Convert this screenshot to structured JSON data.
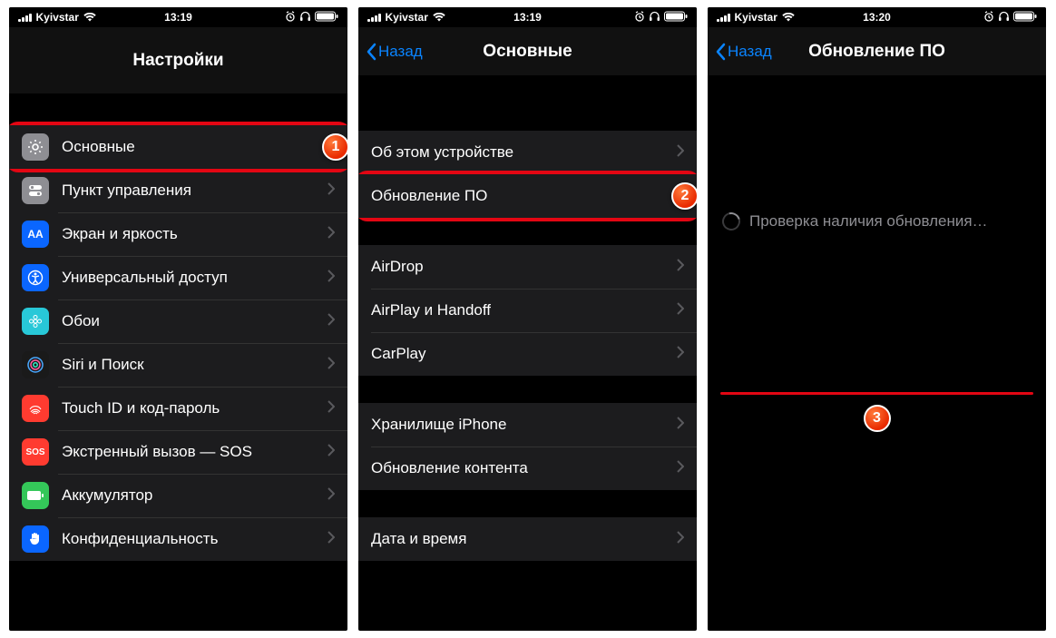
{
  "status": {
    "carrier": "Kyivstar",
    "time": "13:19",
    "time3": "13:20"
  },
  "screen1": {
    "title": "Настройки",
    "rows": {
      "general": "Основные",
      "control": "Пункт управления",
      "display": "Экран и яркость",
      "access": "Универсальный доступ",
      "wallpaper": "Обои",
      "siri": "Siri и Поиск",
      "touchid": "Touch ID и код-пароль",
      "sos": "Экстренный вызов — SOS",
      "battery": "Аккумулятор",
      "privacy": "Конфиденциальность"
    }
  },
  "screen2": {
    "back": "Назад",
    "title": "Основные",
    "g1": {
      "about": "Об этом устройстве",
      "update": "Обновление ПО"
    },
    "g2": {
      "airdrop": "AirDrop",
      "airplay": "AirPlay и Handoff",
      "carplay": "CarPlay"
    },
    "g3": {
      "storage": "Хранилище iPhone",
      "refresh": "Обновление контента"
    },
    "g4": {
      "datetime": "Дата и время"
    }
  },
  "screen3": {
    "back": "Назад",
    "title": "Обновление ПО",
    "checking": "Проверка наличия обновления…"
  },
  "badges": {
    "b1": "1",
    "b2": "2",
    "b3": "3"
  },
  "sos_text": "SOS",
  "aa_text": "AA"
}
